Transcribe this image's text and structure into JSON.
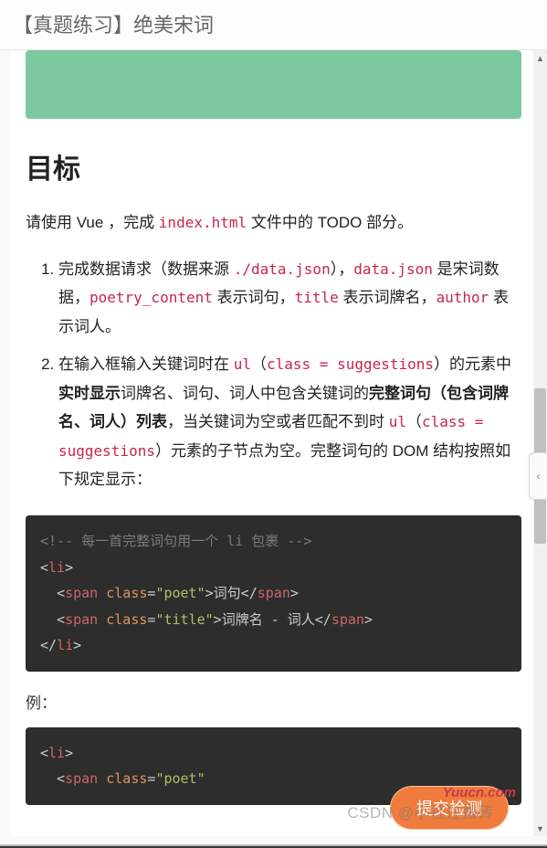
{
  "page_title": "【真题练习】绝美宋词",
  "heading": "目标",
  "intro": {
    "prefix": "请使用 Vue ，完成 ",
    "code": "index.html",
    "suffix": " 文件中的 TODO 部分。"
  },
  "list": {
    "item1": {
      "t1": "完成数据请求（数据来源 ",
      "c1": "./data.json",
      "t2": "），",
      "c2": "data.json",
      "t3": " 是宋词数据，",
      "c3": "poetry_content",
      "t4": " 表示词句，",
      "c4": "title",
      "t5": " 表示词牌名，",
      "c5": "author",
      "t6": " 表示词人。"
    },
    "item2": {
      "t1": "在输入框输入关键词时在 ",
      "c1": "ul",
      "t2": "（",
      "c2": "class = suggestions",
      "t3": "）的元素中",
      "b1": "实时显示",
      "t4": "词牌名、词句、词人中包含关键词的",
      "b2": "完整词句（包含词牌名、词人）列表",
      "t5": "，当关键词为空或者匹配不到时 ",
      "c3": "ul",
      "t6": "（",
      "c4": "class = suggestions",
      "t7": "）元素的子节点为空。完整词句的 DOM 结构按照如下规定显示："
    }
  },
  "code1": {
    "l0": "<!-- 每一首完整词句用一个 li 包裹 -->",
    "li_open": "li",
    "sp_open": "span",
    "cls_attr": "class",
    "poet_val": "\"poet\"",
    "title_val": "\"title\"",
    "txt_poet": "词句",
    "txt_title": "词牌名 - 词人",
    "sp_close": "span",
    "li_close": "li"
  },
  "example_label": "例：",
  "code2": {
    "li_open": "li",
    "sp_open": "span",
    "cls_attr": "class",
    "poet_val": "\"poet\""
  },
  "submit_label": "提交检测",
  "watermark": "CSDN @小社在搬砖",
  "brand": "Yuucn.com"
}
